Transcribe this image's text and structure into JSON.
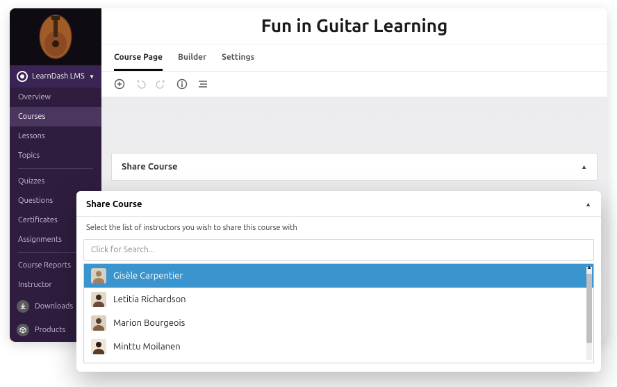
{
  "sidebar": {
    "brand_label": "LearnDash LMS",
    "items": [
      {
        "label": "Overview"
      },
      {
        "label": "Courses",
        "active": true
      },
      {
        "label": "Lessons"
      },
      {
        "label": "Topics"
      }
    ],
    "items2": [
      {
        "label": "Quizzes"
      },
      {
        "label": "Questions"
      },
      {
        "label": "Certificates"
      },
      {
        "label": "Assignments"
      }
    ],
    "items3": [
      {
        "label": "Course Reports"
      },
      {
        "label": "Instructor"
      }
    ],
    "footer": [
      {
        "label": "Downloads"
      },
      {
        "label": "Products"
      }
    ]
  },
  "page": {
    "title": "Fun in Guitar Learning",
    "tabs": [
      {
        "label": "Course Page",
        "active": true
      },
      {
        "label": "Builder"
      },
      {
        "label": "Settings"
      }
    ],
    "accordion_title": "Share Course"
  },
  "popup": {
    "title": "Share Course",
    "note": "Select the list of instructors you wish to share this course with",
    "search_placeholder": "Click for Search...",
    "instructors": [
      {
        "name": "Gisèle Carpentier",
        "selected": true
      },
      {
        "name": "Letitia Richardson"
      },
      {
        "name": "Marion Bourgeois"
      },
      {
        "name": "Minttu Moilanen"
      }
    ]
  }
}
